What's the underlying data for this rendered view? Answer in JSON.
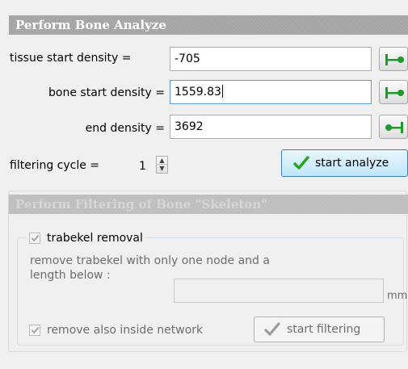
{
  "perform_bone_analyze": {
    "title": "Perform Bone Analyze",
    "tissue_start_density": {
      "label": "tissue start density =",
      "value": "-705"
    },
    "bone_start_density": {
      "label": "bone start density =",
      "value": "1559.83"
    },
    "end_density": {
      "label": "end density =",
      "value": "3692"
    },
    "filtering_cycle": {
      "label": "filtering cycle =",
      "value": "1"
    },
    "start_analyze_label": "start analyze"
  },
  "perform_filtering": {
    "title": "Perform Filtering of Bone \"Skeleton\"",
    "trabekel_removal_label": "trabekel removal",
    "description_line1": "remove trabekel with only one node and a",
    "description_line2": "length below :",
    "length_value": "",
    "unit": "mm",
    "remove_inside_label": "remove also inside network",
    "start_filtering_label": "start filtering"
  },
  "icons": {
    "start_marker": "range-start-marker-icon",
    "end_marker": "range-end-marker-icon",
    "check": "green-check-icon"
  },
  "colors": {
    "header_bg": "#a4a4a4",
    "marker_green": "#1e9a2a",
    "check_green": "#27a11f",
    "primary_border": "#3c7fb1"
  }
}
